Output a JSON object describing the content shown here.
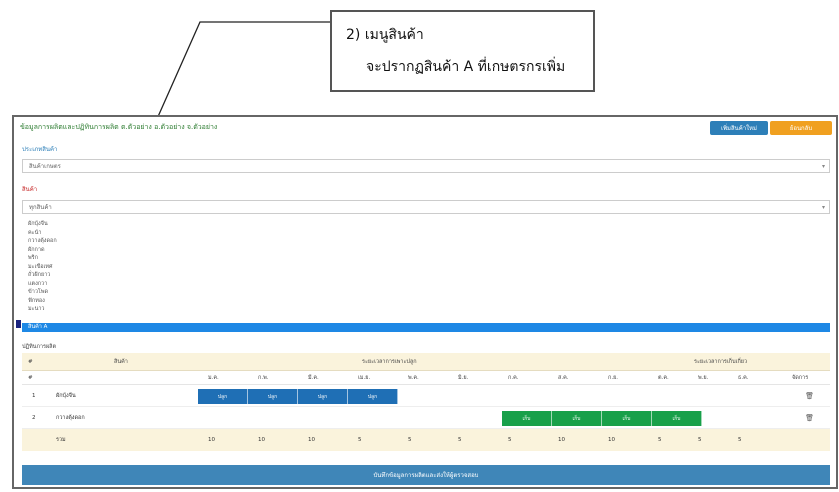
{
  "callout": {
    "line1": "2) เมนูสินค้า",
    "line2": "จะปรากฏสินค้า A ที่เกษตรกรเพิ่ม"
  },
  "app": {
    "title": "ข้อมูลการผลิตและปฏิทินการผลิต ต.ตัวอย่าง อ.ตัวอย่าง จ.ตัวอย่าง",
    "btn_primary": "เพิ่มสินค้าใหม่",
    "btn_secondary": "ย้อนกลับ",
    "field1_label": "ประเภทสินค้า",
    "field1_value": "สินค้าเกษตร",
    "field2_label": "สินค้า",
    "field2_value": "ทุกสินค้า",
    "dropdown_items": [
      "ผักบุ้งจีน",
      "คะน้า",
      "กวางตุ้งดอก",
      "ผักกาด",
      "พริก",
      "มะเขือเทศ",
      "ถั่วฝักยาว",
      "แตงกวา",
      "ข้าวโพด",
      "ฟักทอง",
      "มะนาว"
    ],
    "dropdown_selected": "สินค้า A",
    "section_label": "ปฏิทินการผลิต",
    "table": {
      "head1": {
        "col_no": "#",
        "col_product": "สินค้า",
        "col_group1": "ระยะเวลาการเพาะปลูก",
        "col_group2": "ระยะเวลาการเก็บเกี่ยว"
      },
      "head2": {
        "col_no": "#",
        "months": [
          "ม.ค.",
          "ก.พ.",
          "มี.ค.",
          "เม.ย.",
          "พ.ค.",
          "มิ.ย.",
          "ก.ค.",
          "ส.ค.",
          "ก.ย.",
          "ต.ค.",
          "พ.ย.",
          "ธ.ค."
        ],
        "col_action": "จัดการ"
      },
      "rows": [
        {
          "no": "1",
          "product": "ผักบุ้งจีน",
          "segments": [
            "ปลูก",
            "ปลูก",
            "ปลูก",
            "ปลูก"
          ],
          "color": "#1f6fb5"
        },
        {
          "no": "2",
          "product": "กวางตุ้งดอก",
          "segments": [
            "เก็บ",
            "เก็บ",
            "เก็บ",
            "เก็บ"
          ],
          "color": "#18a04a"
        }
      ],
      "foot": {
        "label": "รวม",
        "values": [
          "10",
          "10",
          "10",
          "5",
          "5",
          "5",
          "5",
          "10",
          "10",
          "5",
          "5",
          "5"
        ]
      }
    },
    "submit_label": "บันทึกข้อมูลการผลิตและส่งให้ผู้ตรวจสอบ"
  }
}
